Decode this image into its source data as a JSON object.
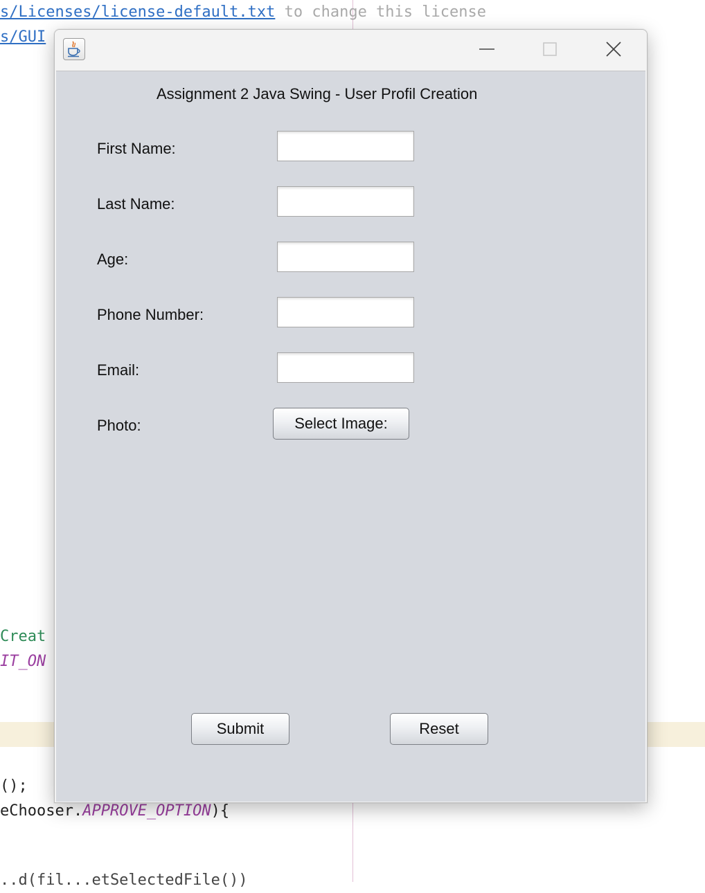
{
  "editor": {
    "line1": {
      "link": "s/Licenses/license-default.txt",
      "comment": " to change this license"
    },
    "line2": "s/GUI",
    "line3": "Creat",
    "line4": "IT_ON",
    "line5": "();",
    "line6": {
      "prefix": "eChooser.",
      "constant": "APPROVE_OPTION",
      "suffix": "){"
    },
    "line7": "..d(fil...etSelectedFile())"
  },
  "window": {
    "icon": "java-coffee-cup-icon",
    "controls": {
      "minimize": "minimize-icon",
      "maximize": "maximize-icon",
      "close": "close-icon"
    }
  },
  "form": {
    "title": "Assignment 2 Java Swing - User Profil Creation",
    "fields": [
      {
        "label": "First Name:",
        "value": ""
      },
      {
        "label": "Last Name:",
        "value": ""
      },
      {
        "label": "Age:",
        "value": ""
      },
      {
        "label": "Phone Number:",
        "value": ""
      },
      {
        "label": "Email:",
        "value": ""
      }
    ],
    "photo_label": "Photo:",
    "select_image_label": "Select Image:",
    "submit_label": "Submit",
    "reset_label": "Reset"
  },
  "colors": {
    "panel_background": "#d6d9df",
    "link": "#2f6fc4",
    "constant": "#9b3fa0"
  }
}
